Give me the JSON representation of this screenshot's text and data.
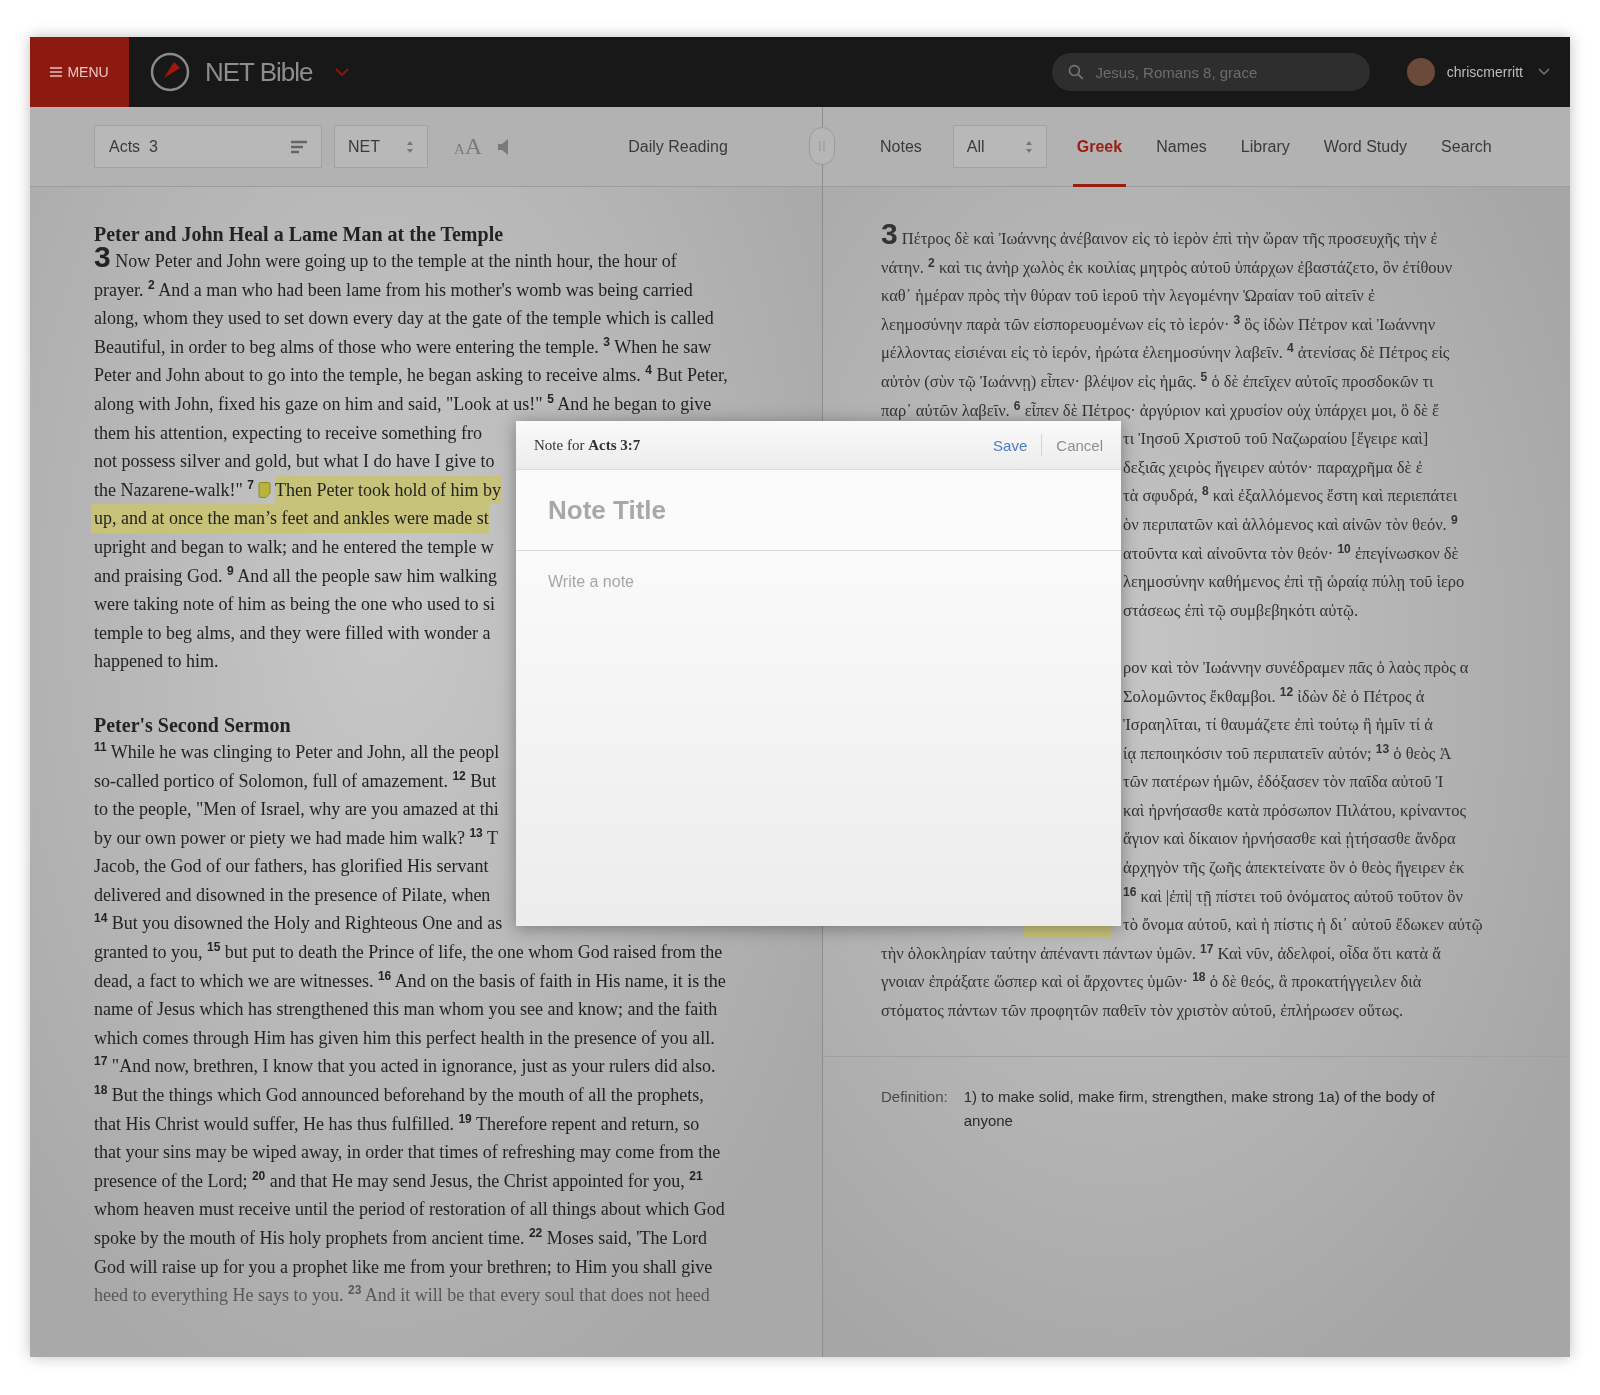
{
  "header": {
    "menu_label": "MENU",
    "app_title": "NET Bible",
    "search": {
      "placeholder": "Jesus, Romans 8, grace"
    },
    "user": {
      "name": "chriscmerritt"
    }
  },
  "reader_toolbar": {
    "passage": "Acts  3",
    "version": "NET",
    "text_size": {
      "small": "A",
      "large": "A"
    },
    "daily_reading": "Daily Reading"
  },
  "study_toolbar": {
    "notes_label": "Notes",
    "notes_filter": "All",
    "tabs": [
      {
        "label": "Greek",
        "selected": true
      },
      {
        "label": "Names",
        "selected": false
      },
      {
        "label": "Library",
        "selected": false
      },
      {
        "label": "Word Study",
        "selected": false
      },
      {
        "label": "Search",
        "selected": false
      }
    ]
  },
  "bible_text": {
    "sections": [
      {
        "heading": "Peter and John Heal a Lame Man at the Temple",
        "lines": [
          {
            "kind": "full",
            "chapter": "3",
            "text": "Now Peter and John were going up to the temple at the ninth hour, the hour of"
          },
          {
            "kind": "full",
            "text": "prayer. $^{2}$ And a man who had been lame from his mother's womb was being carried"
          },
          {
            "kind": "full",
            "text": "along, whom they used to set down every day at the gate of the temple which is called"
          },
          {
            "kind": "full",
            "text": "Beautiful, in order to beg alms of those who were entering the temple. $^{3}$ When he saw"
          },
          {
            "kind": "full",
            "text": "Peter and John about to go into the temple, he began asking to receive alms. $^{4}$ But Peter,"
          },
          {
            "kind": "full",
            "text": "along with John, fixed his gaze on him and said, \"Look at us!\" $^{5}$ And he began to give"
          },
          {
            "kind": "clipped",
            "text": "them his attention, expecting to receive something fro"
          },
          {
            "kind": "clipped",
            "text": "not possess silver and gold, but what I do have I give to"
          },
          {
            "kind": "clipped",
            "segments": [
              {
                "kind": "text",
                "text": "the Nazarene-walk!\" $^{7}$",
                "highlighted": false
              },
              {
                "kind": "note"
              },
              {
                "kind": "text",
                "text": "Then Peter took hold of him by",
                "highlighted": true
              }
            ]
          },
          {
            "kind": "clipped",
            "segments": [
              {
                "kind": "text",
                "text": "up, and at once the man’s feet and ankles were made st",
                "highlighted": true
              }
            ]
          },
          {
            "kind": "clipped",
            "text": "upright and began to walk; and he entered the temple w"
          },
          {
            "kind": "clipped",
            "text": "and praising God. $^{9}$ And all the people saw him walking"
          },
          {
            "kind": "clipped",
            "text": "were taking note of him as being the one who used to si"
          },
          {
            "kind": "clipped",
            "text": "temple to beg alms, and they were filled with wonder a"
          },
          {
            "kind": "full",
            "text": "happened to him."
          }
        ]
      },
      {
        "heading": "Peter's Second Sermon",
        "lines": [
          {
            "kind": "clipped",
            "text": "$^{11}$ While he was clinging to Peter and John, all the peopl"
          },
          {
            "kind": "clipped",
            "text": "so-called portico of Solomon, full of amazement. $^{12}$ But"
          },
          {
            "kind": "clipped",
            "text": "to the people, \"Men of Israel, why are you amazed at thi"
          },
          {
            "kind": "clipped",
            "text": "by our own power or piety we had made him walk? $^{13}$ T"
          },
          {
            "kind": "clipped",
            "text": "Jacob, the God of our fathers, has glorified His servant"
          },
          {
            "kind": "clipped",
            "text": "delivered and disowned in the presence of Pilate, when"
          },
          {
            "kind": "clipped",
            "text": "$^{14}$ But you disowned the Holy and Righteous One and as"
          },
          {
            "kind": "full",
            "text": "granted to you, $^{15}$ but put to death the Prince of life, the one whom God raised from the"
          },
          {
            "kind": "full",
            "text": "dead, a fact to which we are witnesses. $^{16}$ And on the basis of faith in His name, it is the"
          },
          {
            "kind": "full",
            "text": "name of Jesus which has strengthened this man whom you see and know; and the faith"
          },
          {
            "kind": "full",
            "text": "which comes through Him has given him this perfect health in the presence of you all."
          },
          {
            "kind": "full",
            "text": "$^{17}$ \"And now, brethren, I know that you acted in ignorance, just as your rulers did also."
          },
          {
            "kind": "full",
            "text": "$^{18}$ But the things which God announced beforehand by the mouth of all the prophets,"
          },
          {
            "kind": "full",
            "text": "that His Christ would suffer, He has thus fulfilled. $^{19}$ Therefore repent and return, so"
          },
          {
            "kind": "full",
            "text": "that your sins may be wiped away, in order that times of refreshing may come from the"
          },
          {
            "kind": "full",
            "text": "presence of the Lord; $^{20}$ and that He may send Jesus, the Christ appointed for you, $^{21}$"
          },
          {
            "kind": "full",
            "text": "whom heaven must receive until the period of restoration of all things about which God"
          },
          {
            "kind": "full",
            "text": "spoke by the mouth of His holy prophets from ancient time. $^{22}$ Moses said, 'The Lord"
          },
          {
            "kind": "full",
            "text": "God will raise up for you a prophet like me from your brethren; to Him you shall give"
          },
          {
            "kind": "faded",
            "text": "heed to everything He says to you. $^{23}$ And it will be that every soul that does not heed"
          }
        ]
      }
    ]
  },
  "greek_text": {
    "paragraphs": [
      {
        "lines": [
          {
            "kind": "full",
            "chapter": "3",
            "text": "Πέτρος δὲ καὶ Ἰωάννης ἀνέβαινον εἰς τὸ ἱερὸν ἐπὶ τὴν ὥραν τῆς προσευχῆς τὴν ἐ"
          },
          {
            "kind": "full",
            "text": "νάτην. $^{2}$ καὶ τις ἀνὴρ χωλὸς ἐκ κοιλίας μητρὸς αὐτοῦ ὑπάρχων ἐβαστάζετο, ὃν ἐτίθουν"
          },
          {
            "kind": "full",
            "text": "καθ᾽ ἡμέραν πρὸς τὴν θύραν τοῦ ἱεροῦ τὴν λεγομένην Ὡραίαν τοῦ αἰτεῖν ἐ"
          },
          {
            "kind": "full",
            "text": "λεημοσύνην παρὰ τῶν εἰσπορευομένων εἰς τὸ ἱερόν· $^{3}$ ὃς ἰδὼν Πέτρον καὶ Ἰωάννην"
          },
          {
            "kind": "full",
            "text": "μέλλοντας εἰσιέναι εἰς τὸ ἱερόν, ἠρώτα ἐλεημοσύνην λαβεῖν. $^{4}$ ἀτενίσας δὲ Πέτρος εἰς"
          },
          {
            "kind": "full",
            "text": "αὐτὸν (σὺν τῷ Ἰωάννῃ) εἶπεν· βλέψον εἰς ἡμᾶς. $^{5}$ ὁ δὲ ἐπεῖχεν αὐτοῖς προσδοκῶν τι"
          },
          {
            "kind": "full",
            "text": "παρ᾽ αὐτῶν λαβεῖν. $^{6}$ εἶπεν δὲ Πέτρος· ἀργύριον καὶ χρυσίον οὐχ ὑπάρχει μοι, ὃ δὲ ἔ"
          },
          {
            "kind": "clipped",
            "text": "τι Ἰησοῦ Χριστοῦ τοῦ Ναζωραίου [ἔγειρε καὶ]"
          },
          {
            "kind": "clipped",
            "text": "δεξιᾶς χειρὸς ἤγειρεν αὐτόν· παραχρῆμα δὲ ἐ"
          },
          {
            "kind": "clipped",
            "text": "τὰ σφυδρά, $^{8}$ καὶ ἐξαλλόμενος ἔστη καὶ περιεπάτει"
          },
          {
            "kind": "clipped",
            "text": "ὸν περιπατῶν καὶ ἁλλόμενος καὶ αἰνῶν τὸν θεόν. $^{9}$"
          },
          {
            "kind": "clipped",
            "text": "ατοῦντα καὶ αἰνοῦντα τὸν θεόν· $^{10}$ ἐπεγίνωσκον δὲ"
          },
          {
            "kind": "clipped",
            "text": "λεημοσύνην καθήμενος ἐπὶ τῇ ὡραίᾳ πύλῃ τοῦ ἱερο"
          },
          {
            "kind": "clipped",
            "text": "στάσεως ἐπὶ τῷ συμβεβηκότι αὐτῷ."
          }
        ]
      },
      {
        "lines": [
          {
            "kind": "clipped",
            "text": "ρον καὶ τὸν Ἰωάννην συνέδραμεν πᾶς ὁ λαὸς πρὸς α"
          },
          {
            "kind": "clipped",
            "text": "Σολομῶντος ἔκθαμβοι. $^{12}$ ἰδὼν δὲ ὁ Πέτρος ἀ"
          },
          {
            "kind": "clipped",
            "text": "Ἰσραηλῖται, τί θαυμάζετε ἐπὶ τούτῳ ἢ ἡμῖν τί ἀ"
          },
          {
            "kind": "clipped",
            "text": "ίᾳ πεποιηκόσιν τοῦ περιπατεῖν αὐτόν; $^{13}$ ὁ θεὸς Ἀ"
          },
          {
            "kind": "clipped",
            "text": "τῶν πατέρων ἡμῶν, ἐδόξασεν τὸν παῖδα αὐτοῦ Ἰ"
          },
          {
            "kind": "clipped",
            "text": "καὶ ἠρνήσασθε κατὰ πρόσωπον Πιλάτου, κρίναντος"
          },
          {
            "kind": "clipped",
            "text": "ἅγιον καὶ δίκαιον ἠρνήσασθε καὶ ᾐτήσασθε ἄνδρα"
          },
          {
            "kind": "clipped",
            "text": "ἀρχηγὸν τῆς ζωῆς ἀπεκτείνατε ὃν ὁ θεὸς ἤγειρεν ἐκ"
          },
          {
            "kind": "clipped",
            "text": "$^{16}$ καὶ |ἐπὶ| τῇ πίστει τοῦ ὀνόματος αὐτοῦ τοῦτον ὃν"
          },
          {
            "kind": "clipped",
            "covered_highlight": true,
            "text": "τὸ ὄνομα αὐτοῦ, καὶ ἡ πίστις ἡ δι᾽ αὐτοῦ ἔδωκεν αὐτῷ"
          },
          {
            "kind": "full",
            "text": "τὴν ὁλοκληρίαν ταύτην ἀπέναντι πάντων ὑμῶν. $^{17}$ Καὶ νῦν, ἀδελφοί, οἶδα ὅτι κατὰ ἄ"
          },
          {
            "kind": "full",
            "text": "γνοιαν ἐπράξατε ὥσπερ καὶ οἱ ἄρχοντες ὑμῶν· $^{18}$ ὁ δὲ θεός, ἃ προκατήγγειλεν διὰ"
          },
          {
            "kind": "full",
            "text": "στόματος πάντων τῶν προφητῶν παθεῖν τὸν χριστὸν αὐτοῦ, ἐπλήρωσεν οὕτως."
          }
        ]
      }
    ]
  },
  "definition": {
    "label": "Definition:",
    "text": "1) to make solid, make firm, strengthen, make strong 1a) of the body of anyone"
  },
  "note_dialog": {
    "title": "Note for **Acts 3:7**",
    "save": "Save",
    "cancel": "Cancel",
    "title_placeholder": "Note Title",
    "body_placeholder": "Write a note"
  }
}
